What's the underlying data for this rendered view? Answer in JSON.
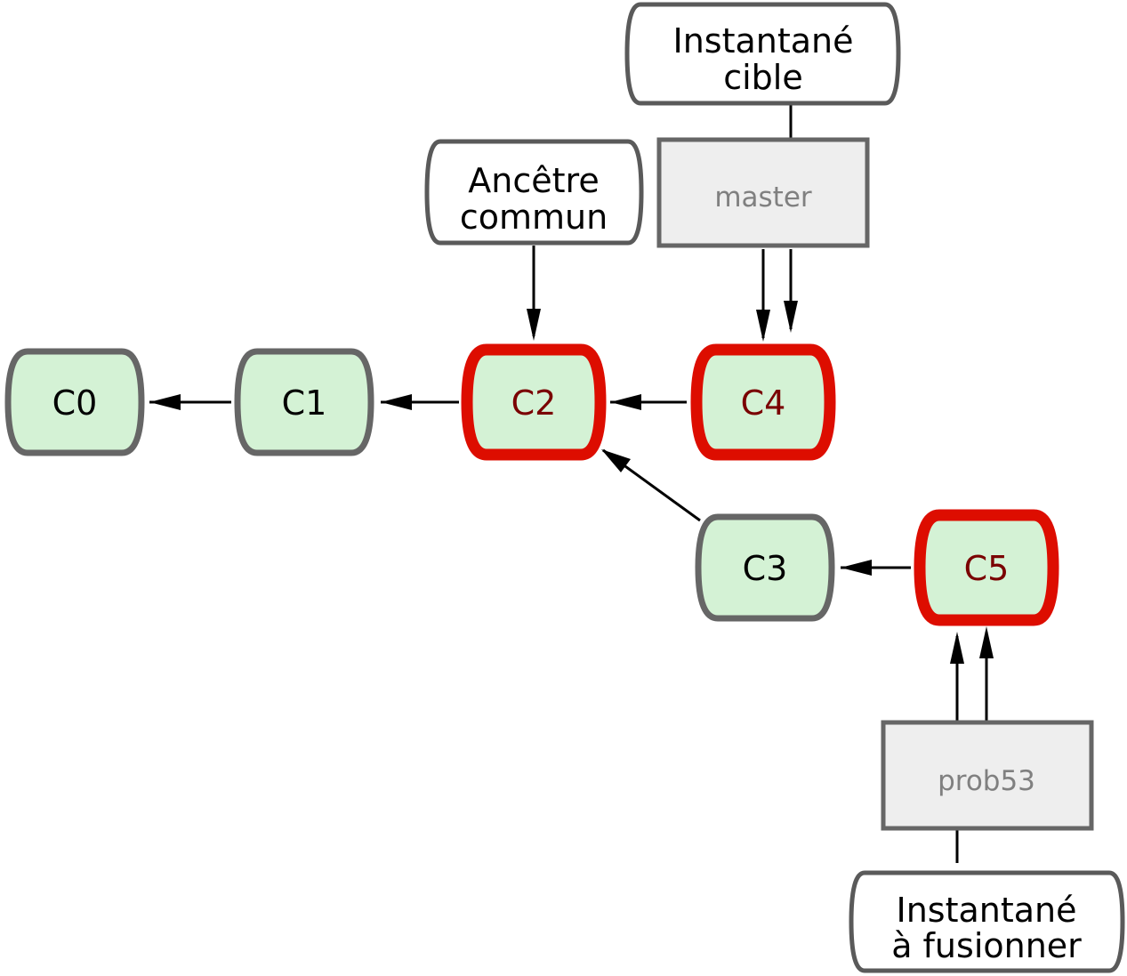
{
  "diagram": {
    "colors": {
      "commit_fill": "#d4f2d5",
      "commit_stroke": "#666666",
      "highlight_stroke": "#dd0d00",
      "highlight_text": "#7a0000",
      "normal_text": "#000000",
      "branch_fill": "#eeeeee",
      "branch_stroke": "#666666",
      "branch_text": "#808080",
      "label_stroke": "#5a5a5a"
    },
    "commits": [
      {
        "id": "c0",
        "label": "C0",
        "highlighted": false
      },
      {
        "id": "c1",
        "label": "C1",
        "highlighted": false
      },
      {
        "id": "c2",
        "label": "C2",
        "highlighted": true
      },
      {
        "id": "c4",
        "label": "C4",
        "highlighted": true
      },
      {
        "id": "c3",
        "label": "C3",
        "highlighted": false
      },
      {
        "id": "c5",
        "label": "C5",
        "highlighted": true
      }
    ],
    "branches": [
      {
        "id": "master",
        "label": "master"
      },
      {
        "id": "prob53",
        "label": "prob53"
      }
    ],
    "labels": [
      {
        "id": "target",
        "lines": [
          "Instantané",
          "cible"
        ]
      },
      {
        "id": "ancestor",
        "lines": [
          "Ancêtre",
          "commun"
        ]
      },
      {
        "id": "merge",
        "lines": [
          "Instantané",
          "à fusionner"
        ]
      }
    ],
    "edges": [
      {
        "from": "C1",
        "to": "C0"
      },
      {
        "from": "C2",
        "to": "C1"
      },
      {
        "from": "C4",
        "to": "C2"
      },
      {
        "from": "C3",
        "to": "C2"
      },
      {
        "from": "C5",
        "to": "C3"
      },
      {
        "from": "master",
        "to": "C4"
      },
      {
        "from": "prob53",
        "to": "C5"
      },
      {
        "from": "Ancêtre commun",
        "to": "C2"
      },
      {
        "from": "Instantané cible",
        "to": "C4"
      },
      {
        "from": "Instantané à fusionner",
        "to": "C5"
      }
    ]
  }
}
